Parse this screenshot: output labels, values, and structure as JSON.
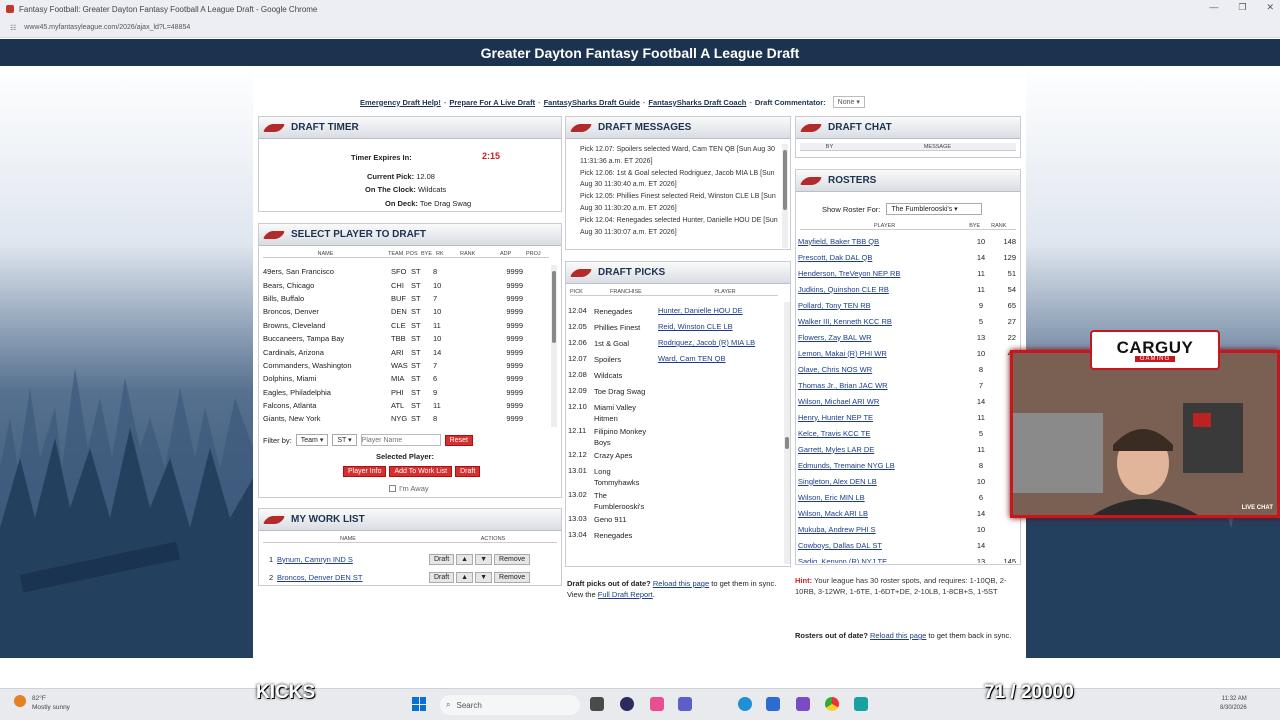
{
  "browser": {
    "window_title": "Fantasy Football: Greater Dayton Fantasy Football A League Draft - Google Chrome",
    "url": "www45.myfantasyleague.com/2026/ajax_ld?L=48854"
  },
  "site": {
    "title": "Greater Dayton Fantasy Football A League Draft"
  },
  "toplinks": {
    "emergency": "Emergency Draft Help!",
    "prepare": "Prepare For A Live Draft",
    "guide": "FantasySharks Draft Guide",
    "coach": "FantasySharks Draft Coach",
    "commentator_label": "Draft Commentator:",
    "commentator_value": "None",
    "sep": "-"
  },
  "draft_timer": {
    "heading": "DRAFT TIMER",
    "expires_label": "Timer Expires In:",
    "expires_value": "2:15",
    "current_pick_label": "Current Pick:",
    "current_pick_value": "12.08",
    "on_clock_label": "On The Clock:",
    "on_clock_value": "Wildcats",
    "on_deck_label": "On Deck:",
    "on_deck_value": "Toe Drag Swag"
  },
  "select_player": {
    "heading": "SELECT PLAYER TO DRAFT",
    "columns": [
      "NAME",
      "TEAM",
      "POS",
      "BYE",
      "RK",
      "RANK",
      "ADP",
      "PROJ"
    ],
    "players": [
      {
        "name": "49ers, San Francisco",
        "team": "SFO",
        "pos": "ST",
        "bye": "8",
        "adp": "9999"
      },
      {
        "name": "Bears, Chicago",
        "team": "CHI",
        "pos": "ST",
        "bye": "10",
        "adp": "9999"
      },
      {
        "name": "Bills, Buffalo",
        "team": "BUF",
        "pos": "ST",
        "bye": "7",
        "adp": "9999"
      },
      {
        "name": "Broncos, Denver",
        "team": "DEN",
        "pos": "ST",
        "bye": "10",
        "adp": "9999"
      },
      {
        "name": "Browns, Cleveland",
        "team": "CLE",
        "pos": "ST",
        "bye": "11",
        "adp": "9999"
      },
      {
        "name": "Buccaneers, Tampa Bay",
        "team": "TBB",
        "pos": "ST",
        "bye": "10",
        "adp": "9999"
      },
      {
        "name": "Cardinals, Arizona",
        "team": "ARI",
        "pos": "ST",
        "bye": "14",
        "adp": "9999"
      },
      {
        "name": "Commanders, Washington",
        "team": "WAS",
        "pos": "ST",
        "bye": "7",
        "adp": "9999"
      },
      {
        "name": "Dolphins, Miami",
        "team": "MIA",
        "pos": "ST",
        "bye": "6",
        "adp": "9999"
      },
      {
        "name": "Eagles, Philadelphia",
        "team": "PHI",
        "pos": "ST",
        "bye": "9",
        "adp": "9999"
      },
      {
        "name": "Falcons, Atlanta",
        "team": "ATL",
        "pos": "ST",
        "bye": "11",
        "adp": "9999"
      },
      {
        "name": "Giants, New York",
        "team": "NYG",
        "pos": "ST",
        "bye": "8",
        "adp": "9999"
      }
    ],
    "filter_label": "Filter by:",
    "filter_team": "Team",
    "filter_pos": "ST",
    "search_placeholder": "Player Name",
    "reset_label": "Reset",
    "selected_player_label": "Selected Player:",
    "player_info_label": "Player Info",
    "add_work_list_label": "Add To Work List",
    "draft_label": "Draft",
    "away_label": "I'm Away"
  },
  "work_list": {
    "heading": "MY WORK LIST",
    "col_name": "NAME",
    "col_actions": "ACTIONS",
    "items": [
      {
        "num": "1",
        "name": "Bynum, Camryn IND S"
      },
      {
        "num": "2",
        "name": "Broncos, Denver DEN ST"
      }
    ],
    "draft_btn": "Draft",
    "up_btn": "▲",
    "down_btn": "▼",
    "remove_btn": "Remove"
  },
  "draft_messages": {
    "heading": "DRAFT MESSAGES",
    "messages": [
      "Pick 12.07: Spoilers selected Ward, Cam TEN QB [Sun Aug 30 11:31:36 a.m. ET 2026]",
      "Pick 12.06: 1st & Goal selected Rodriguez, Jacob MIA LB [Sun Aug 30 11:30:40 a.m. ET 2026]",
      "Pick 12.05: Phillies Finest selected Reid, Winston CLE LB [Sun Aug 30 11:30:20 a.m. ET 2026]",
      "Pick 12.04: Renegades selected Hunter, Danielle HOU DE [Sun Aug 30 11:30:07 a.m. ET 2026]"
    ]
  },
  "draft_picks": {
    "heading": "DRAFT PICKS",
    "col_pick": "PICK",
    "col_franchise": "FRANCHISE",
    "col_player": "PLAYER",
    "rows": [
      {
        "pick": "12.04",
        "franchise": "Renegades",
        "player": "Hunter, Danielle HOU DE"
      },
      {
        "pick": "12.05",
        "franchise": "Phillies Finest",
        "player": "Reid, Winston CLE LB"
      },
      {
        "pick": "12.06",
        "franchise": "1st & Goal",
        "player": "Rodriguez, Jacob (R) MIA LB"
      },
      {
        "pick": "12.07",
        "franchise": "Spoilers",
        "player": "Ward, Cam TEN QB"
      },
      {
        "pick": "12.08",
        "franchise": "Wildcats",
        "player": ""
      },
      {
        "pick": "12.09",
        "franchise": "Toe Drag Swag",
        "player": ""
      },
      {
        "pick": "12.10",
        "franchise": "Miami Valley Hitmen",
        "player": ""
      },
      {
        "pick": "12.11",
        "franchise": "Filipino Monkey Boys",
        "player": ""
      },
      {
        "pick": "12.12",
        "franchise": "Crazy Apes",
        "player": ""
      },
      {
        "pick": "13.01",
        "franchise": "Long Tommyhawks",
        "player": ""
      },
      {
        "pick": "13.02",
        "franchise": "The Fumblerooski's",
        "player": ""
      },
      {
        "pick": "13.03",
        "franchise": "Geno 911",
        "player": ""
      },
      {
        "pick": "13.04",
        "franchise": "Renegades",
        "player": ""
      }
    ],
    "out_of_date": "Draft picks out of date?",
    "reload_link": "Reload this page",
    "sync_text": "to get them in sync. View the",
    "report_link": "Full Draft Report",
    "period": "."
  },
  "draft_chat": {
    "heading": "DRAFT CHAT",
    "col_by": "BY",
    "col_message": "MESSAGE"
  },
  "rosters": {
    "heading": "ROSTERS",
    "show_for_label": "Show Roster For:",
    "show_for_value": "The Fumblerooski's",
    "col_player": "PLAYER",
    "col_bye": "BYE",
    "col_rank": "RANK",
    "players": [
      {
        "name": "Mayfield, Baker TBB QB",
        "bye": "10",
        "rank": "148"
      },
      {
        "name": "Prescott, Dak DAL QB",
        "bye": "14",
        "rank": "129"
      },
      {
        "name": "Henderson, TreVeyon NEP RB",
        "bye": "11",
        "rank": "51"
      },
      {
        "name": "Judkins, Quinshon CLE RB",
        "bye": "11",
        "rank": "54"
      },
      {
        "name": "Pollard, Tony TEN RB",
        "bye": "9",
        "rank": "65"
      },
      {
        "name": "Walker III, Kenneth KCC RB",
        "bye": "5",
        "rank": "27"
      },
      {
        "name": "Flowers, Zay BAL WR",
        "bye": "13",
        "rank": "22"
      },
      {
        "name": "Lemon, Makai (R) PHI WR",
        "bye": "10",
        "rank": "42"
      },
      {
        "name": "Olave, Chris NOS WR",
        "bye": "8",
        "rank": ""
      },
      {
        "name": "Thomas Jr., Brian JAC WR",
        "bye": "7",
        "rank": ""
      },
      {
        "name": "Wilson, Michael ARI WR",
        "bye": "14",
        "rank": ""
      },
      {
        "name": "Henry, Hunter NEP TE",
        "bye": "11",
        "rank": ""
      },
      {
        "name": "Kelce, Travis KCC TE",
        "bye": "5",
        "rank": ""
      },
      {
        "name": "Garrett, Myles LAR DE",
        "bye": "11",
        "rank": ""
      },
      {
        "name": "Edmunds, Tremaine NYG LB",
        "bye": "8",
        "rank": ""
      },
      {
        "name": "Singleton, Alex DEN LB",
        "bye": "10",
        "rank": ""
      },
      {
        "name": "Wilson, Eric MIN LB",
        "bye": "6",
        "rank": ""
      },
      {
        "name": "Wilson, Mack ARI LB",
        "bye": "14",
        "rank": ""
      },
      {
        "name": "Mukuba, Andrew PHI S",
        "bye": "10",
        "rank": ""
      },
      {
        "name": "Cowboys, Dallas DAL ST",
        "bye": "14",
        "rank": ""
      },
      {
        "name": "Sadiq, Kenyon (R) NYJ TE",
        "bye": "13",
        "rank": "145"
      }
    ],
    "hint_label": "Hint:",
    "hint_text": "Your league has 30 roster spots, and requires: 1-10QB, 2-10RB, 3-12WR, 1-6TE, 1-6DT+DE, 2-10LB, 1-8CB+S, 1-5ST",
    "out_of_date": "Rosters out of date?",
    "reload_link": "Reload this page",
    "sync_text": "to get them back in sync."
  },
  "stream_overlay": {
    "kicks_label": "KICKS",
    "counter": "71 / 20000",
    "logo_main": "CARGUY",
    "logo_sub": "GAMING",
    "live_chat": "LIVE CHAT"
  },
  "taskbar": {
    "weather_temp": "82°F",
    "weather_desc": "Mostly sunny",
    "search_label": "Search",
    "time": "11:32 AM",
    "date": "8/30/2026"
  },
  "colors": {
    "header_navy": "#1c3350",
    "accent_red": "#d01e1e",
    "link_blue": "#1c3e8a"
  }
}
